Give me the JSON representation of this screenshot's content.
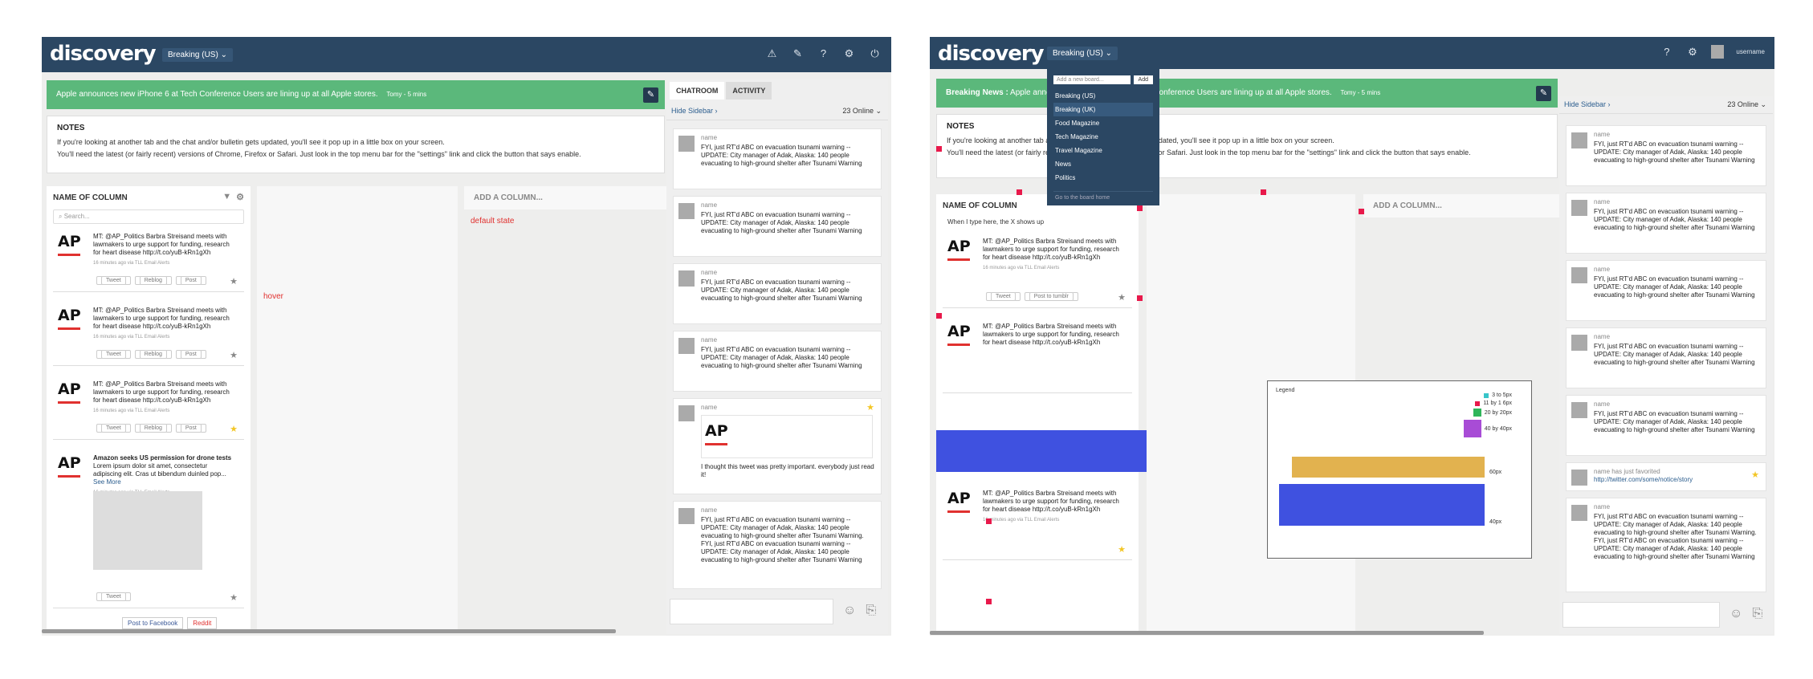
{
  "app": {
    "logo": "discovery",
    "board_label": "Breaking (US)",
    "username": "username"
  },
  "left": {
    "alert": {
      "text": "Apple announces new iPhone 6 at Tech Conference Users are lining up at all Apple stores.",
      "time": "Tomy - 5 mins"
    },
    "notes": {
      "title": "NOTES",
      "line1": "If you're looking at another tab and the chat and/or bulletin gets updated, you'll see it pop up in a little box on your screen.",
      "line2": "You'll need the latest (or fairly recent) versions of Chrome, Firefox or Safari. Just look in the top menu bar for the \"settings\" link and click the button that says enable."
    },
    "column": {
      "title": "NAME OF COLUMN",
      "search_placeholder": "Search...",
      "cards": [
        {
          "text": "MT: @AP_Politics Barbra Streisand meets with lawmakers to urge support for funding, research for heart disease http://t.co/yuB-kRn1gXh",
          "meta": "16 minutes ago via TLL Email Alerts"
        },
        {
          "text": "MT: @AP_Politics Barbra Streisand meets with lawmakers to urge support for funding, research for heart disease http://t.co/yuB-kRn1gXh",
          "meta": "16 minutes ago via TLL Email Alerts"
        },
        {
          "text": "MT: @AP_Politics Barbra Streisand meets with lawmakers to urge support for funding, research for heart disease http://t.co/yuB-kRn1gXh",
          "meta": "16 minutes ago via TLL Email Alerts"
        },
        {
          "title": "Amazon seeks US permission for drone tests",
          "text": "Lorem ipsum dolor sit amet, consectetur adipiscing elit. Cras ut bibendum duinled pop...",
          "more": "See More",
          "meta": "16 minutes ago via TLL Email Alerts"
        }
      ],
      "tweet": "Tweet",
      "reblog": "Reblog",
      "post": "Post",
      "post_facebook": "Post to Facebook",
      "reddit": "Reddit"
    },
    "hover_label": "hover",
    "default_label": "default state",
    "add_column": "ADD A COLUMN...",
    "tabs": [
      "CHATROOM",
      "ACTIVITY"
    ],
    "hide_sidebar": "Hide Sidebar",
    "online": "23 Online",
    "messages": [
      {
        "name": "name",
        "text": "FYI, just RT'd ABC on evacuation tsunami warning -- UPDATE: City manager of Adak, Alaska: 140 people evacuating to high-ground shelter after Tsunami Warning"
      },
      {
        "name": "name",
        "text": "FYI, just RT'd ABC on evacuation tsunami warning -- UPDATE: City manager of Adak, Alaska: 140 people evacuating to high-ground shelter after Tsunami Warning"
      },
      {
        "name": "name",
        "text": "FYI, just RT'd ABC on evacuation tsunami warning -- UPDATE: City manager of Adak, Alaska: 140 people evacuating to high-ground shelter after Tsunami Warning"
      },
      {
        "name": "name",
        "text": "FYI, just RT'd ABC on evacuation tsunami warning -- UPDATE: City manager of Adak, Alaska: 140 people evacuating to high-ground shelter after Tsunami Warning"
      },
      {
        "name": "name",
        "text": "I thought this tweet was pretty important. everybody just read it!"
      },
      {
        "name": "name",
        "text": "FYI, just RT'd ABC on evacuation tsunami warning -- UPDATE: City manager of Adak, Alaska: 140 people evacuating to high-ground shelter after Tsunami Warning. FYI, just RT'd ABC on evacuation tsunami warning -- UPDATE: City manager of Adak, Alaska: 140 people evacuating to high-ground shelter after Tsunami Warning"
      }
    ]
  },
  "right": {
    "alert": {
      "prefix": "Breaking News :",
      "text": "Apple announces new iPhone 6 at Tech Conference Users are lining up at all Apple stores.",
      "time": "Tomy - 5 mins"
    },
    "dropdown": {
      "placeholder": "Add a new board...",
      "add": "Add",
      "options": [
        "Breaking (US)",
        "Breaking (UK)",
        "Food Magazine",
        "Tech Magazine",
        "Travel Magazine",
        "News",
        "Politics"
      ],
      "goto": "Go to the board home"
    },
    "column_title": "NAME OF COLUMN",
    "typing_hint": "When I type here, the X shows up",
    "add_column": "ADD A COLUMN...",
    "hide_sidebar": "Hide Sidebar",
    "online": "23 Online",
    "post_to_tumblr": "Post to tumblr",
    "legend": {
      "title": "Legend",
      "items": [
        "3 to 5px",
        "11 by 1 6px",
        "20 by 20px",
        "40 by 40px",
        "60px",
        "40px"
      ]
    },
    "favorited": {
      "name": "name has just favorited",
      "link": "http://twitter.com/some/notice/story"
    }
  },
  "colors": {
    "topbar": "#2b4763",
    "alert": "#5bb87b",
    "accent": "#e0312f",
    "star": "#f3c626"
  }
}
